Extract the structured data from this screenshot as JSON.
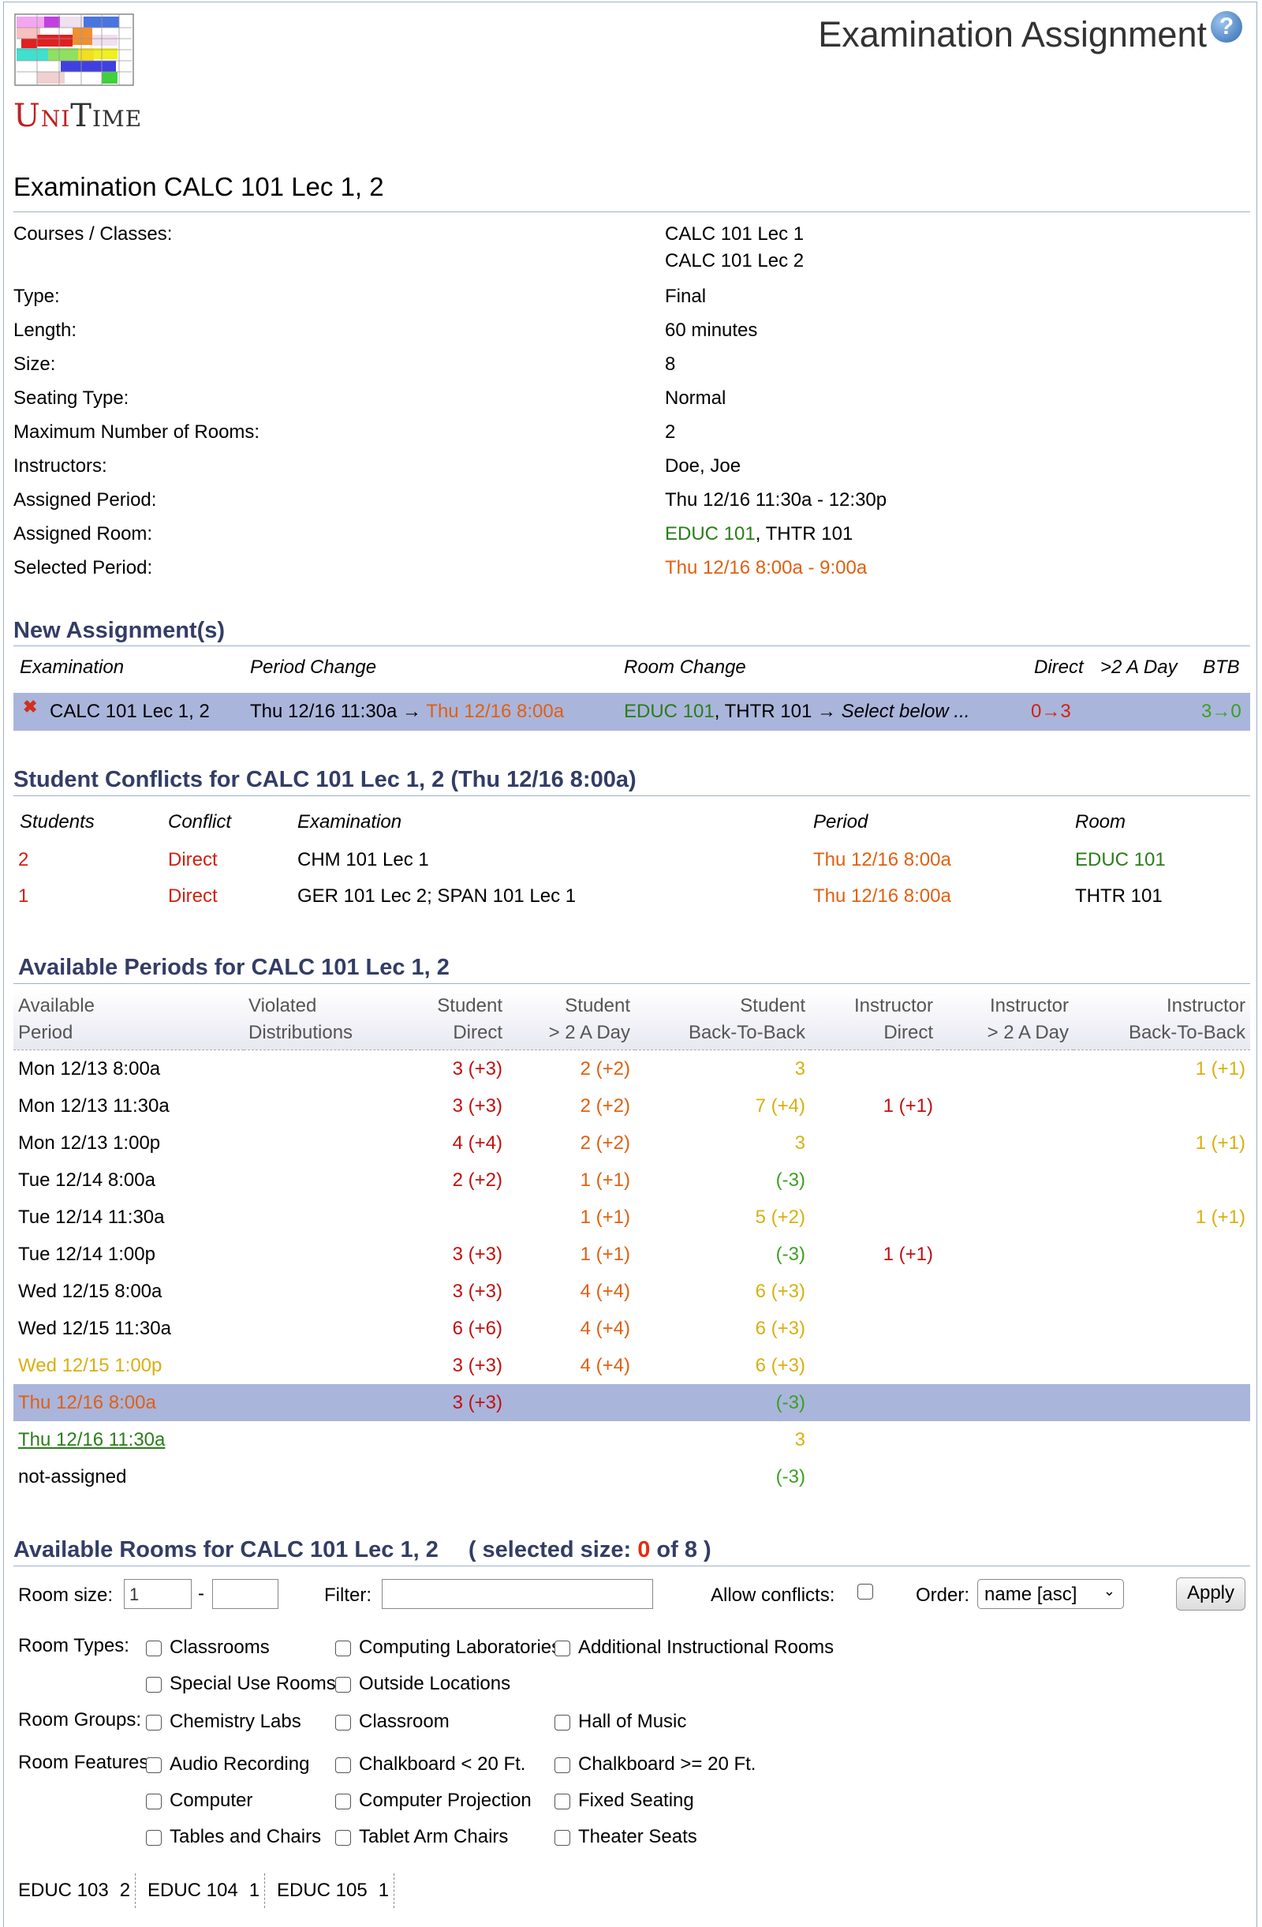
{
  "header": {
    "page_title": "Examination Assignment",
    "help_icon": "?",
    "logo_text": "UniTime"
  },
  "exam": {
    "title": "Examination CALC 101 Lec 1, 2",
    "props": [
      {
        "label": "Courses / Classes:",
        "value": "CALC 101 Lec 1",
        "value2": "CALC 101 Lec 2"
      },
      {
        "label": "Type:",
        "value": "Final"
      },
      {
        "label": "Length:",
        "value": "60 minutes"
      },
      {
        "label": "Size:",
        "value": "8"
      },
      {
        "label": "Seating Type:",
        "value": "Normal"
      },
      {
        "label": "Maximum Number of Rooms:",
        "value": "2"
      },
      {
        "label": "Instructors:",
        "value": "Doe, Joe"
      },
      {
        "label": "Assigned Period:",
        "value": "Thu 12/16 11:30a - 12:30p"
      },
      {
        "label": "Assigned Room:",
        "room1": "EDUC 101",
        "sep": ", ",
        "room2": "THTR 101"
      },
      {
        "label": "Selected Period:",
        "value": "Thu 12/16 8:00a - 9:00a"
      }
    ]
  },
  "new_assignments": {
    "title": "New Assignment(s)",
    "headers": [
      "Examination",
      "Period Change",
      "Room Change",
      "Direct",
      ">2 A Day",
      "BTB"
    ],
    "row": {
      "exam": "CALC 101 Lec 1, 2",
      "period_from": "Thu 12/16 11:30a",
      "arrow": " → ",
      "period_to": "Thu 12/16 8:00a",
      "room1": "EDUC 101",
      "room_sep": ", THTR 101 → ",
      "room_to": "Select below ...",
      "direct": "0→3",
      "btb": "3→0"
    }
  },
  "conflicts": {
    "title": "Student Conflicts for CALC 101 Lec 1, 2 (Thu 12/16 8:00a)",
    "headers": [
      "Students",
      "Conflict",
      "Examination",
      "Period",
      "Room"
    ],
    "rows": [
      {
        "students": "2",
        "conflict": "Direct",
        "exam": "CHM 101 Lec 1",
        "period": "Thu 12/16 8:00a",
        "room": "EDUC 101"
      },
      {
        "students": "1",
        "conflict": "Direct",
        "exam": "GER 101 Lec 2; SPAN 101 Lec 1",
        "period": "Thu 12/16 8:00a",
        "room": "THTR 101"
      }
    ]
  },
  "periods": {
    "title": "Available Periods for CALC 101 Lec 1, 2",
    "headers": [
      {
        "l1": "Available",
        "l2": "Period"
      },
      {
        "l1": "Violated",
        "l2": "Distributions"
      },
      {
        "l1": "Student",
        "l2": "Direct"
      },
      {
        "l1": "Student",
        "l2": "> 2 A Day"
      },
      {
        "l1": "Student",
        "l2": "Back-To-Back"
      },
      {
        "l1": "Instructor",
        "l2": "Direct"
      },
      {
        "l1": "Instructor",
        "l2": "> 2 A Day"
      },
      {
        "l1": "Instructor",
        "l2": "Back-To-Back"
      }
    ],
    "rows": [
      {
        "period": "Mon 12/13 8:00a",
        "sd": "3 (+3)",
        "s2": "2 (+2)",
        "sb": "3",
        "sbc": "yellow",
        "id": "",
        "ib": "1 (+1)"
      },
      {
        "period": "Mon 12/13 11:30a",
        "sd": "3 (+3)",
        "s2": "2 (+2)",
        "sb": "7 (+4)",
        "sbc": "yellow",
        "id": "1 (+1)",
        "ib": ""
      },
      {
        "period": "Mon 12/13 1:00p",
        "sd": "4 (+4)",
        "s2": "2 (+2)",
        "sb": "3",
        "sbc": "yellow",
        "id": "",
        "ib": "1 (+1)"
      },
      {
        "period": "Tue 12/14 8:00a",
        "sd": "2 (+2)",
        "s2": "1 (+1)",
        "sb": "(-3)",
        "sbc": "lgreen",
        "id": "",
        "ib": ""
      },
      {
        "period": "Tue 12/14 11:30a",
        "sd": "",
        "s2": "1 (+1)",
        "sb": "5 (+2)",
        "sbc": "yellow",
        "id": "",
        "ib": "1 (+1)"
      },
      {
        "period": "Tue 12/14 1:00p",
        "sd": "3 (+3)",
        "s2": "1 (+1)",
        "sb": "(-3)",
        "sbc": "lgreen",
        "id": "1 (+1)",
        "ib": ""
      },
      {
        "period": "Wed 12/15 8:00a",
        "sd": "3 (+3)",
        "s2": "4 (+4)",
        "sb": "6 (+3)",
        "sbc": "yellow",
        "id": "",
        "ib": ""
      },
      {
        "period": "Wed 12/15 11:30a",
        "sd": "6 (+6)",
        "s2": "4 (+4)",
        "sb": "6 (+3)",
        "sbc": "yellow",
        "id": "",
        "ib": ""
      },
      {
        "period": "Wed 12/15 1:00p",
        "pc": "yellow",
        "sd": "3 (+3)",
        "s2": "4 (+4)",
        "sb": "6 (+3)",
        "sbc": "yellow",
        "id": "",
        "ib": ""
      },
      {
        "period": "Thu 12/16 8:00a",
        "pc": "orange",
        "selected": true,
        "sd": "3 (+3)",
        "s2": "",
        "sb": "(-3)",
        "sbc": "lgreen",
        "id": "",
        "ib": ""
      },
      {
        "period": "Thu 12/16 11:30a",
        "pc": "green-u",
        "sd": "",
        "s2": "",
        "sb": "3",
        "sbc": "yellow",
        "id": "",
        "ib": ""
      },
      {
        "period": "not-assigned",
        "sd": "",
        "s2": "",
        "sb": "(-3)",
        "sbc": "lgreen",
        "id": "",
        "ib": ""
      }
    ]
  },
  "rooms": {
    "title_a": "Available Rooms for CALC 101 Lec 1, 2",
    "title_b": "( selected size: ",
    "title_n": "0",
    "title_c": " of 8 )",
    "room_size_label": "Room size:",
    "room_size_min": "1",
    "room_size_dash": "-",
    "filter_label": "Filter:",
    "allow_conflicts_label": "Allow conflicts:",
    "order_label": "Order:",
    "order_value": "name [asc]",
    "apply_label": "Apply",
    "types_label": "Room Types:",
    "types": [
      "Classrooms",
      "Computing Laboratories",
      "Additional Instructional Rooms",
      "Special Use Rooms",
      "Outside Locations"
    ],
    "groups_label": "Room Groups:",
    "groups": [
      "Chemistry Labs",
      "Classroom",
      "Hall of Music"
    ],
    "features_label": "Room Features:",
    "features": [
      "Audio Recording",
      "Chalkboard < 20 Ft.",
      "Chalkboard >= 20 Ft.",
      "Computer",
      "Computer Projection",
      "Fixed Seating",
      "Tables and Chairs",
      "Tablet Arm Chairs",
      "Theater Seats"
    ],
    "list": [
      {
        "name": "EDUC 103",
        "size": "2"
      },
      {
        "name": "EDUC 104",
        "size": "1"
      },
      {
        "name": "EDUC 105",
        "size": "1"
      }
    ]
  }
}
